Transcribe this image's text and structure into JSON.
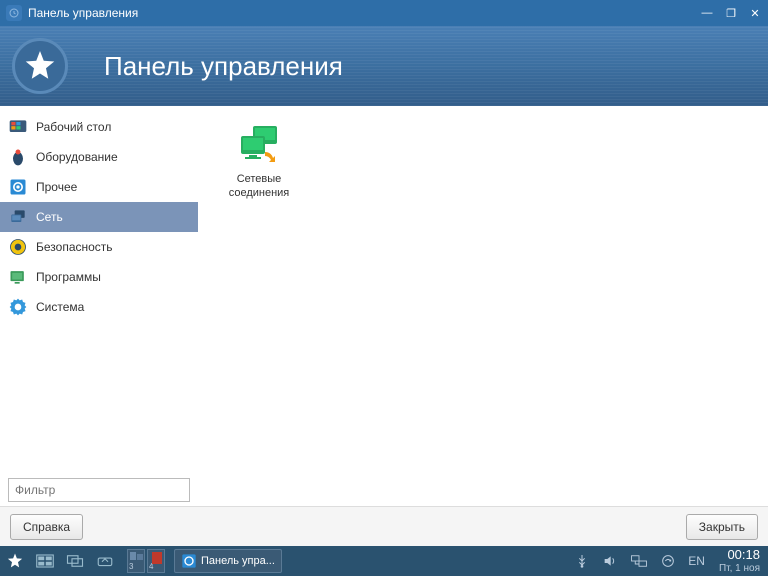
{
  "window": {
    "title": "Панель управления"
  },
  "header": {
    "title": "Панель управления"
  },
  "sidebar": {
    "items": [
      {
        "label": "Рабочий стол"
      },
      {
        "label": "Оборудование"
      },
      {
        "label": "Прочее"
      },
      {
        "label": "Сеть"
      },
      {
        "label": "Безопасность"
      },
      {
        "label": "Программы"
      },
      {
        "label": "Система"
      }
    ],
    "active_index": 3,
    "filter_placeholder": "Фильтр"
  },
  "content": {
    "items": [
      {
        "label": "Сетевые соединения"
      }
    ]
  },
  "footer": {
    "help": "Справка",
    "close": "Закрыть"
  },
  "taskbar": {
    "task_label": "Панель упра...",
    "pager": [
      "3",
      "4"
    ],
    "lang": "EN",
    "time": "00:18",
    "date": "Пт, 1 ноя"
  }
}
